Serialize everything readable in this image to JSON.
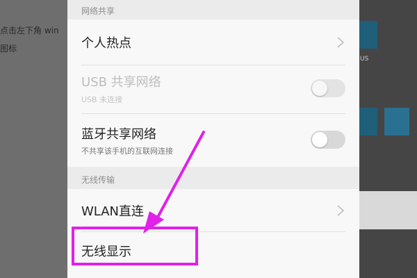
{
  "background": {
    "instruction_lines": [
      "点击左下角 win",
      "图标"
    ],
    "partial_label": "US"
  },
  "sections": [
    {
      "header": "网络共享",
      "items": [
        {
          "title": "个人热点",
          "subtitle": "",
          "control": "chevron",
          "enabled": true
        },
        {
          "title": "USB 共享网络",
          "subtitle": "USB 未连接",
          "control": "toggle",
          "toggle_on": false,
          "enabled": false
        },
        {
          "title": "蓝牙共享网络",
          "subtitle": "不共享该手机的互联网连接",
          "control": "toggle",
          "toggle_on": false,
          "enabled": true
        }
      ]
    },
    {
      "header": "无线传输",
      "items": [
        {
          "title": "WLAN直连",
          "subtitle": "",
          "control": "chevron",
          "enabled": true
        },
        {
          "title": "无线显示",
          "subtitle": "",
          "control": "none",
          "enabled": true,
          "highlighted": true
        }
      ]
    }
  ],
  "annotation": {
    "color": "#e021e8",
    "target": "无线显示"
  }
}
